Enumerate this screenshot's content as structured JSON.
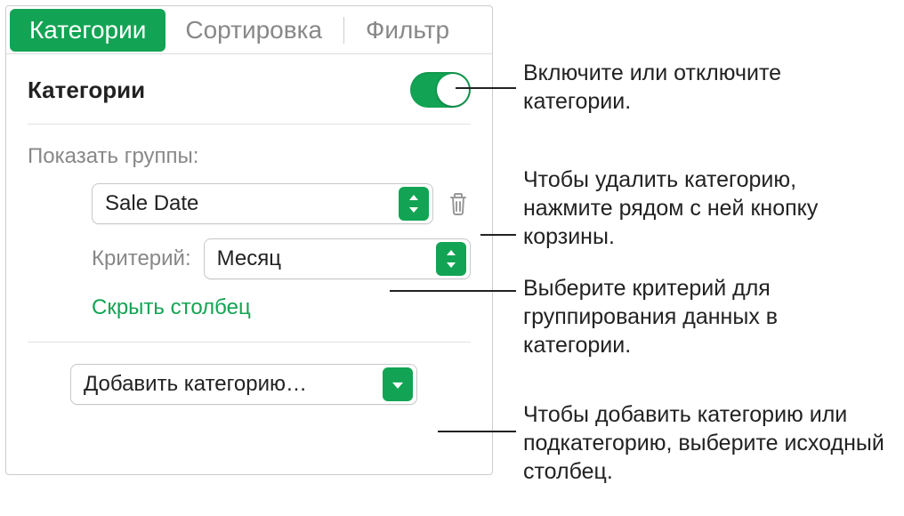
{
  "tabs": {
    "categories": "Категории",
    "sort": "Сортировка",
    "filter": "Фильтр"
  },
  "section": {
    "title": "Категории"
  },
  "groups": {
    "label": "Показать группы:",
    "select_value": "Sale Date",
    "criterion_label": "Критерий:",
    "criterion_value": "Месяц",
    "hide_column": "Скрыть столбец"
  },
  "add": {
    "label": "Добавить категорию…"
  },
  "callouts": {
    "toggle": "Включите или отключите категории.",
    "delete": "Чтобы удалить категорию, нажмите рядом с ней кнопку корзины.",
    "criterion": "Выберите критерий для группирования данных в категории.",
    "add": "Чтобы добавить категорию или подкатегорию, выберите исходный столбец."
  }
}
